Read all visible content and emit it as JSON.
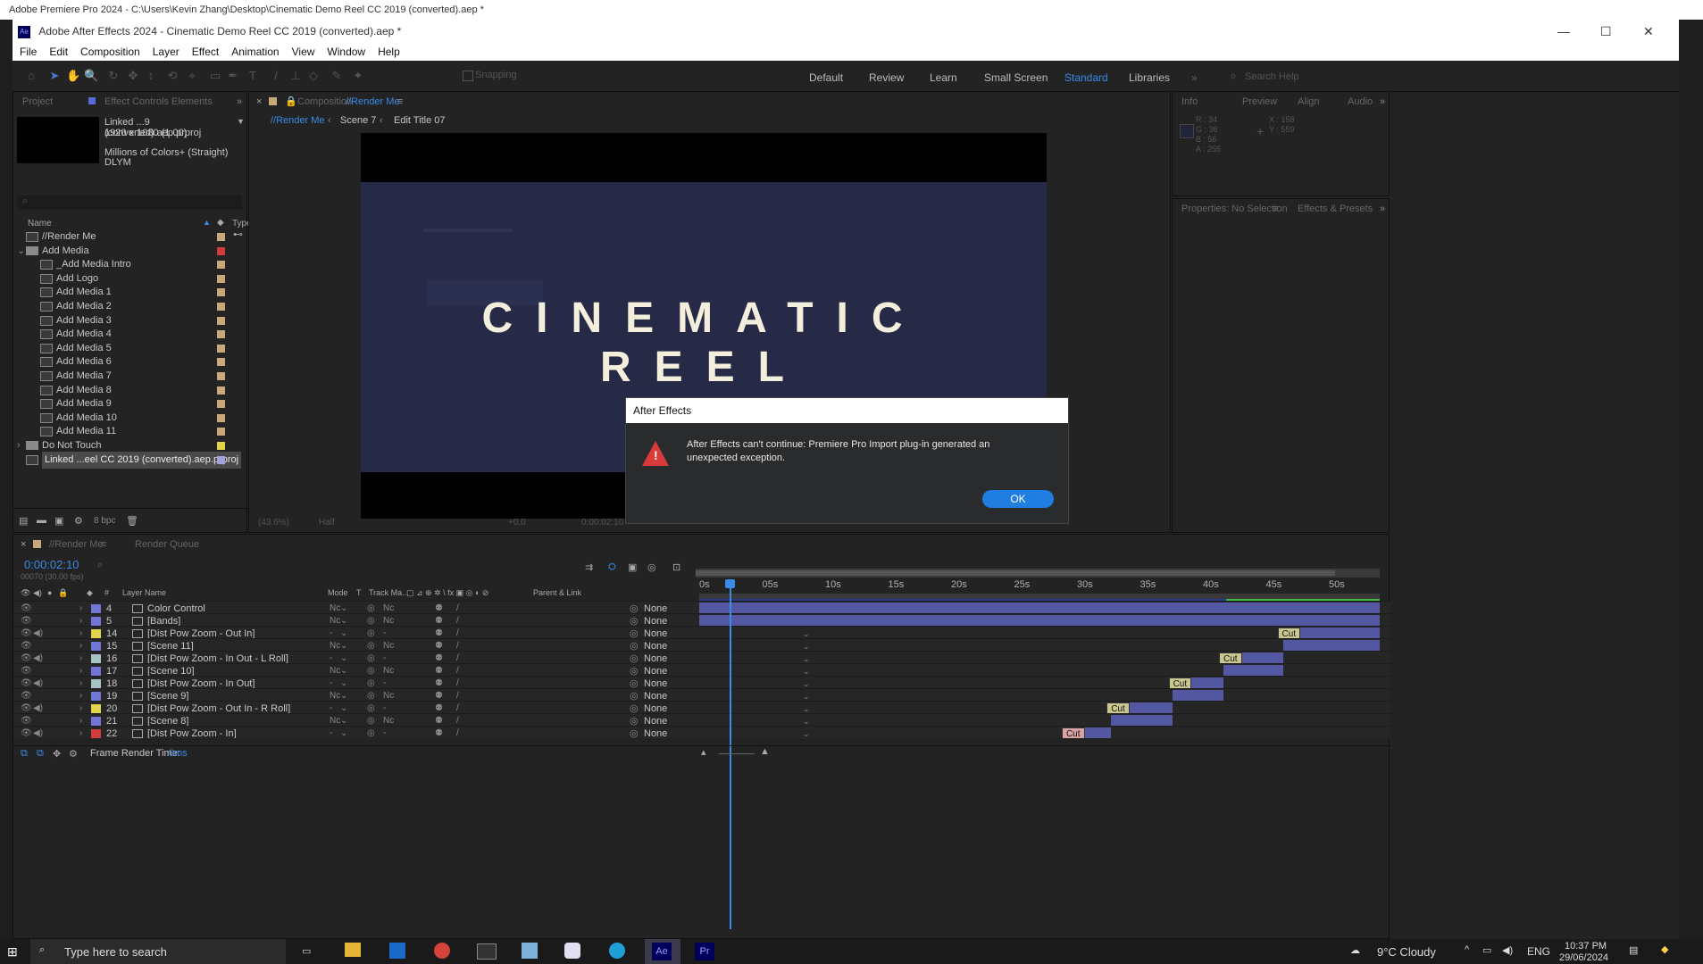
{
  "premiere": {
    "title": "Adobe Premiere Pro 2024 - C:\\Users\\Kevin Zhang\\Desktop\\Cinematic Demo Reel CC 2019 (converted).aep *"
  },
  "ae": {
    "title": "Adobe After Effects 2024 - Cinematic Demo Reel CC 2019 (converted).aep *",
    "menu": [
      "File",
      "Edit",
      "Composition",
      "Layer",
      "Effect",
      "Animation",
      "View",
      "Window",
      "Help"
    ],
    "snapping": "Snapping",
    "workspaces": [
      "Default",
      "Review",
      "Learn",
      "Small Screen",
      "Standard",
      "Libraries"
    ],
    "search_placeholder": "Search Help"
  },
  "project": {
    "tab_project": "Project",
    "tab_effect_controls": "Effect Controls Elements",
    "linked_name": "Linked ...9 (converted).aep.prproj",
    "resolution": "1920 x 1080 (1.00)",
    "colors": "Millions of Colors+ (Straight)",
    "codec": "DLYM",
    "col_name": "Name",
    "col_type": "Type",
    "items": [
      {
        "label": "//Render Me",
        "kind": "comp",
        "indent": 0,
        "color": "#c9a97a"
      },
      {
        "label": "Add Media",
        "kind": "folder",
        "indent": 0,
        "color": "#d13c3c",
        "open": true
      },
      {
        "label": "_Add Media Intro",
        "kind": "comp",
        "indent": 1,
        "color": "#c9a97a"
      },
      {
        "label": "Add Logo",
        "kind": "comp",
        "indent": 1,
        "color": "#c9a97a"
      },
      {
        "label": "Add Media 1",
        "kind": "comp",
        "indent": 1,
        "color": "#c9a97a"
      },
      {
        "label": "Add Media 2",
        "kind": "comp",
        "indent": 1,
        "color": "#c9a97a"
      },
      {
        "label": "Add Media 3",
        "kind": "comp",
        "indent": 1,
        "color": "#c9a97a"
      },
      {
        "label": "Add Media 4",
        "kind": "comp",
        "indent": 1,
        "color": "#c9a97a"
      },
      {
        "label": "Add Media 5",
        "kind": "comp",
        "indent": 1,
        "color": "#c9a97a"
      },
      {
        "label": "Add Media 6",
        "kind": "comp",
        "indent": 1,
        "color": "#c9a97a"
      },
      {
        "label": "Add Media 7",
        "kind": "comp",
        "indent": 1,
        "color": "#c9a97a"
      },
      {
        "label": "Add Media 8",
        "kind": "comp",
        "indent": 1,
        "color": "#c9a97a"
      },
      {
        "label": "Add Media 9",
        "kind": "comp",
        "indent": 1,
        "color": "#c9a97a"
      },
      {
        "label": "Add Media 10",
        "kind": "comp",
        "indent": 1,
        "color": "#c9a97a"
      },
      {
        "label": "Add Media 11",
        "kind": "comp",
        "indent": 1,
        "color": "#c9a97a"
      },
      {
        "label": "Do Not Touch",
        "kind": "folder",
        "indent": 0,
        "color": "#e2d34a"
      },
      {
        "label": "Linked ...eel CC 2019 (converted).aep.prproj",
        "kind": "linked",
        "indent": 0,
        "color": "#a3a3d9",
        "selected": true
      }
    ],
    "bpc": "8 bpc"
  },
  "comp": {
    "tab_label": "Composition",
    "tab_name": "//Render Me",
    "crumbs": [
      "//Render Me",
      "Scene 7",
      "Edit Title 07"
    ],
    "title_text": "CINEMATIC REEL",
    "zoom": "(43.6%)",
    "resolution": "Half",
    "exposure": "+0.0",
    "timecode": "0:00:02:10"
  },
  "info": {
    "tabs": [
      "Info",
      "Preview",
      "Align",
      "Audio"
    ],
    "r": "R : 34",
    "g": "G : 36",
    "b": "B : 56",
    "a": "A : 255",
    "x": "X : 158",
    "y": "Y : 559"
  },
  "properties": {
    "tab": "Properties: No Selection",
    "tab2": "Effects & Presets"
  },
  "timeline": {
    "tab": "//Render Me",
    "tab2": "Render Queue",
    "timecode": "0:00:02:10",
    "frames": "00070 (30.00 fps)",
    "col_layer": "Layer Name",
    "col_mode": "Mode",
    "col_t": "T",
    "col_track": "Track Ma...",
    "col_parent": "Parent & Link",
    "ruler": [
      "0s",
      "05s",
      "10s",
      "15s",
      "20s",
      "25s",
      "30s",
      "35s",
      "40s",
      "45s",
      "50s"
    ],
    "frame_render": "Frame Render Time:",
    "frame_render_val": "0ms",
    "layers": [
      {
        "n": "4",
        "name": "Color Control",
        "color": "#6f78d6",
        "mode": "Nc",
        "parent": "None",
        "audio": false,
        "bar_start": 0,
        "bar_end": 1
      },
      {
        "n": "5",
        "name": "[Bands]",
        "color": "#6f78d6",
        "mode": "Nc",
        "parent": "None",
        "audio": false,
        "bar_start": 0,
        "bar_end": 1
      },
      {
        "n": "14",
        "name": "[Dist Pow Zoom - Out In]",
        "color": "#e2d34a",
        "mode": "-",
        "parent": "None",
        "audio": true,
        "bar_start": 0.855,
        "bar_end": 1,
        "cut": "#c9c78f"
      },
      {
        "n": "15",
        "name": "[Scene 11]",
        "color": "#6f78d6",
        "mode": "Nc",
        "parent": "None",
        "audio": false,
        "bar_start": 0.858,
        "bar_end": 1
      },
      {
        "n": "16",
        "name": "[Dist Pow Zoom - In Out - L Roll]",
        "color": "#a5c4c4",
        "mode": "-",
        "parent": "None",
        "audio": true,
        "bar_start": 0.769,
        "bar_end": 0.858,
        "cut": "#c9c78f"
      },
      {
        "n": "17",
        "name": "[Scene 10]",
        "color": "#6f78d6",
        "mode": "Nc",
        "parent": "None",
        "audio": false,
        "bar_start": 0.77,
        "bar_end": 0.858
      },
      {
        "n": "18",
        "name": "[Dist Pow Zoom - In Out]",
        "color": "#a5c4c4",
        "mode": "-",
        "parent": "None",
        "audio": true,
        "bar_start": 0.695,
        "bar_end": 0.77,
        "cut": "#c9c78f"
      },
      {
        "n": "19",
        "name": "[Scene 9]",
        "color": "#6f78d6",
        "mode": "Nc",
        "parent": "None",
        "audio": false,
        "bar_start": 0.696,
        "bar_end": 0.77
      },
      {
        "n": "20",
        "name": "[Dist Pow Zoom - Out In - R Roll]",
        "color": "#e2d34a",
        "mode": "-",
        "parent": "None",
        "audio": true,
        "bar_start": 0.604,
        "bar_end": 0.696,
        "cut": "#c9c78f"
      },
      {
        "n": "21",
        "name": "[Scene 8]",
        "color": "#6f78d6",
        "mode": "Nc",
        "parent": "None",
        "audio": false,
        "bar_start": 0.605,
        "bar_end": 0.696
      },
      {
        "n": "22",
        "name": "[Dist Pow Zoom - In]",
        "color": "#d13c3c",
        "mode": "-",
        "parent": "None",
        "audio": true,
        "bar_start": 0.538,
        "bar_end": 0.605,
        "cut": "#d9a3a3"
      }
    ],
    "cut_label": "Cut"
  },
  "dialog": {
    "title": "After Effects",
    "message": "After Effects can't continue: Premiere Pro Import plug-in generated an unexpected exception.",
    "ok": "OK"
  },
  "taskbar": {
    "search_placeholder": "Type here to search",
    "weather": "9°C  Cloudy",
    "lang": "ENG",
    "time": "10:37 PM",
    "date": "29/06/2024"
  }
}
